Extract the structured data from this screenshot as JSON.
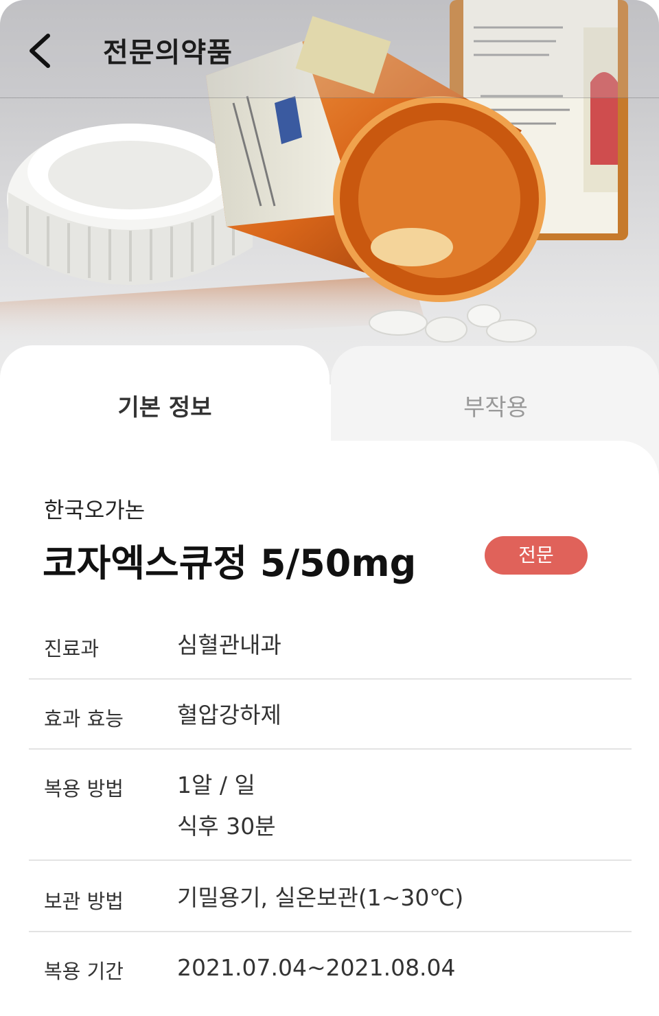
{
  "header": {
    "back_icon": "chevron-left-icon",
    "title": "전문의약품"
  },
  "hero": {
    "image": "prescription-pill-bottle-photo"
  },
  "tabs": [
    {
      "label": "기본 정보",
      "active": true
    },
    {
      "label": "부작용",
      "active": false
    }
  ],
  "drug": {
    "manufacturer": "한국오가논",
    "name": "코자엑스큐정 5/50mg",
    "badge": "전문",
    "badge_color": "#e0625a"
  },
  "info": [
    {
      "label": "진료과",
      "value": [
        "심혈관내과"
      ]
    },
    {
      "label": "효과 효능",
      "value": [
        "혈압강하제"
      ]
    },
    {
      "label": "복용 방법",
      "value": [
        "1알 / 일",
        "식후 30분"
      ]
    },
    {
      "label": "보관 방법",
      "value": [
        "기밀용기, 실온보관(1~30℃)"
      ]
    },
    {
      "label": "복용 기간",
      "value": [
        "2021.07.04~2021.08.04"
      ]
    }
  ]
}
